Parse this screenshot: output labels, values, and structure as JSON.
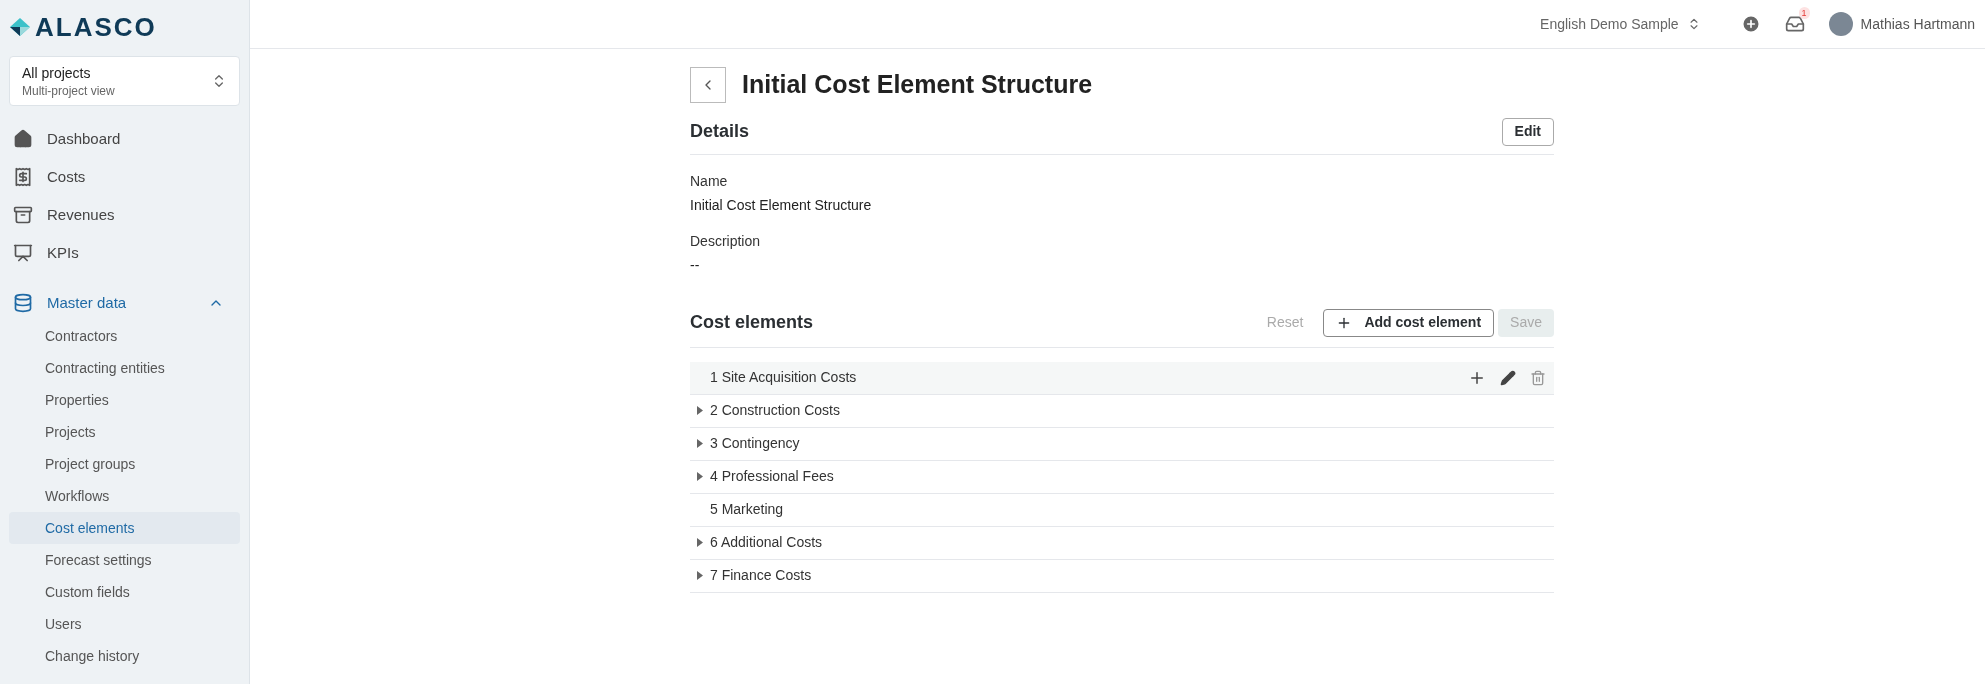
{
  "logo": {
    "text": "ALASCO"
  },
  "project_selector": {
    "title": "All projects",
    "subtitle": "Multi-project view"
  },
  "nav": [
    {
      "label": "Dashboard",
      "kind": "home"
    },
    {
      "label": "Costs",
      "kind": "costs"
    },
    {
      "label": "Revenues",
      "kind": "revenues"
    },
    {
      "label": "KPIs",
      "kind": "kpis"
    }
  ],
  "master_data": {
    "label": "Master data",
    "expanded": true,
    "items": [
      {
        "label": "Contractors",
        "selected": false
      },
      {
        "label": "Contracting entities",
        "selected": false
      },
      {
        "label": "Properties",
        "selected": false
      },
      {
        "label": "Projects",
        "selected": false
      },
      {
        "label": "Project groups",
        "selected": false
      },
      {
        "label": "Workflows",
        "selected": false
      },
      {
        "label": "Cost elements",
        "selected": true
      },
      {
        "label": "Forecast settings",
        "selected": false
      },
      {
        "label": "Custom fields",
        "selected": false
      },
      {
        "label": "Users",
        "selected": false
      },
      {
        "label": "Change history",
        "selected": false
      }
    ]
  },
  "topbar": {
    "workspace": "English Demo Sample",
    "notifications": "1",
    "user": "Mathias Hartmann"
  },
  "page": {
    "title": "Initial Cost Element Structure"
  },
  "details": {
    "title": "Details",
    "edit_button": "Edit",
    "fields": [
      {
        "label": "Name",
        "value": "Initial Cost Element Structure"
      },
      {
        "label": "Description",
        "value": "--"
      }
    ]
  },
  "cost_elements": {
    "title": "Cost elements",
    "reset": "Reset",
    "add": "Add cost element",
    "save": "Save",
    "save_disabled": true,
    "rows": [
      {
        "label": "1 Site Acquisition Costs",
        "has_children": false,
        "highlighted": true
      },
      {
        "label": "2 Construction Costs",
        "has_children": true,
        "highlighted": false
      },
      {
        "label": "3 Contingency",
        "has_children": true,
        "highlighted": false
      },
      {
        "label": "4 Professional Fees",
        "has_children": true,
        "highlighted": false
      },
      {
        "label": "5 Marketing",
        "has_children": false,
        "highlighted": false
      },
      {
        "label": "6 Additional Costs",
        "has_children": true,
        "highlighted": false
      },
      {
        "label": "7 Finance Costs",
        "has_children": true,
        "highlighted": false
      }
    ]
  }
}
